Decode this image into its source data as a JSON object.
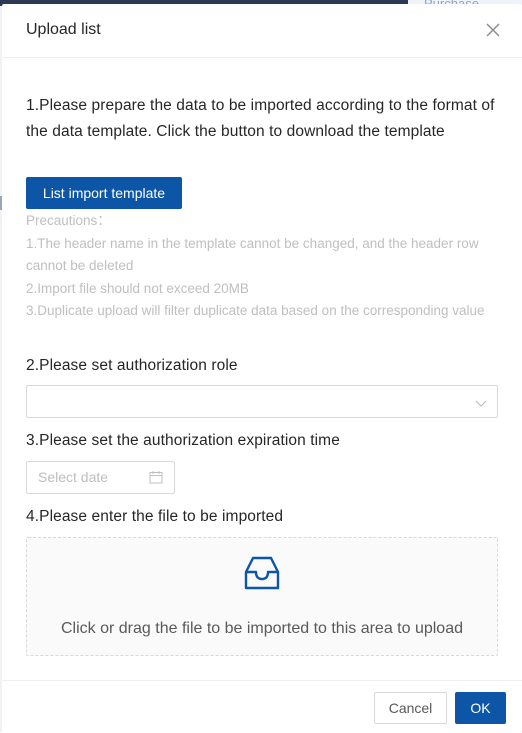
{
  "background": {
    "purchase_label": "Purchase"
  },
  "modal": {
    "title": "Upload list"
  },
  "steps": {
    "step1": "1.Please prepare the data to be imported according to the format of the data template. Click the button to download the template",
    "template_button": "List import template",
    "precautions": [
      "Precautions：",
      "1.The header name in the template cannot be changed, and the header row cannot be deleted",
      "2.Import file should not exceed 20MB",
      "3.Duplicate upload will filter duplicate data based on the corresponding value"
    ],
    "step2": "2.Please set authorization role",
    "role_value": "",
    "step3": "3.Please set the authorization expiration time",
    "date_placeholder": "Select date",
    "step4": "4.Please enter the file to be imported",
    "upload_hint": "Click or drag the file to be imported to this area to upload"
  },
  "footer": {
    "cancel": "Cancel",
    "ok": "OK"
  },
  "icons": {
    "close": "close-icon",
    "dropdown": "chevron-down-icon",
    "calendar": "calendar-icon",
    "upload": "inbox-icon"
  },
  "colors": {
    "primary": "#0d55a6",
    "muted_text": "#bfbfbf",
    "border": "#d9d9d9"
  }
}
